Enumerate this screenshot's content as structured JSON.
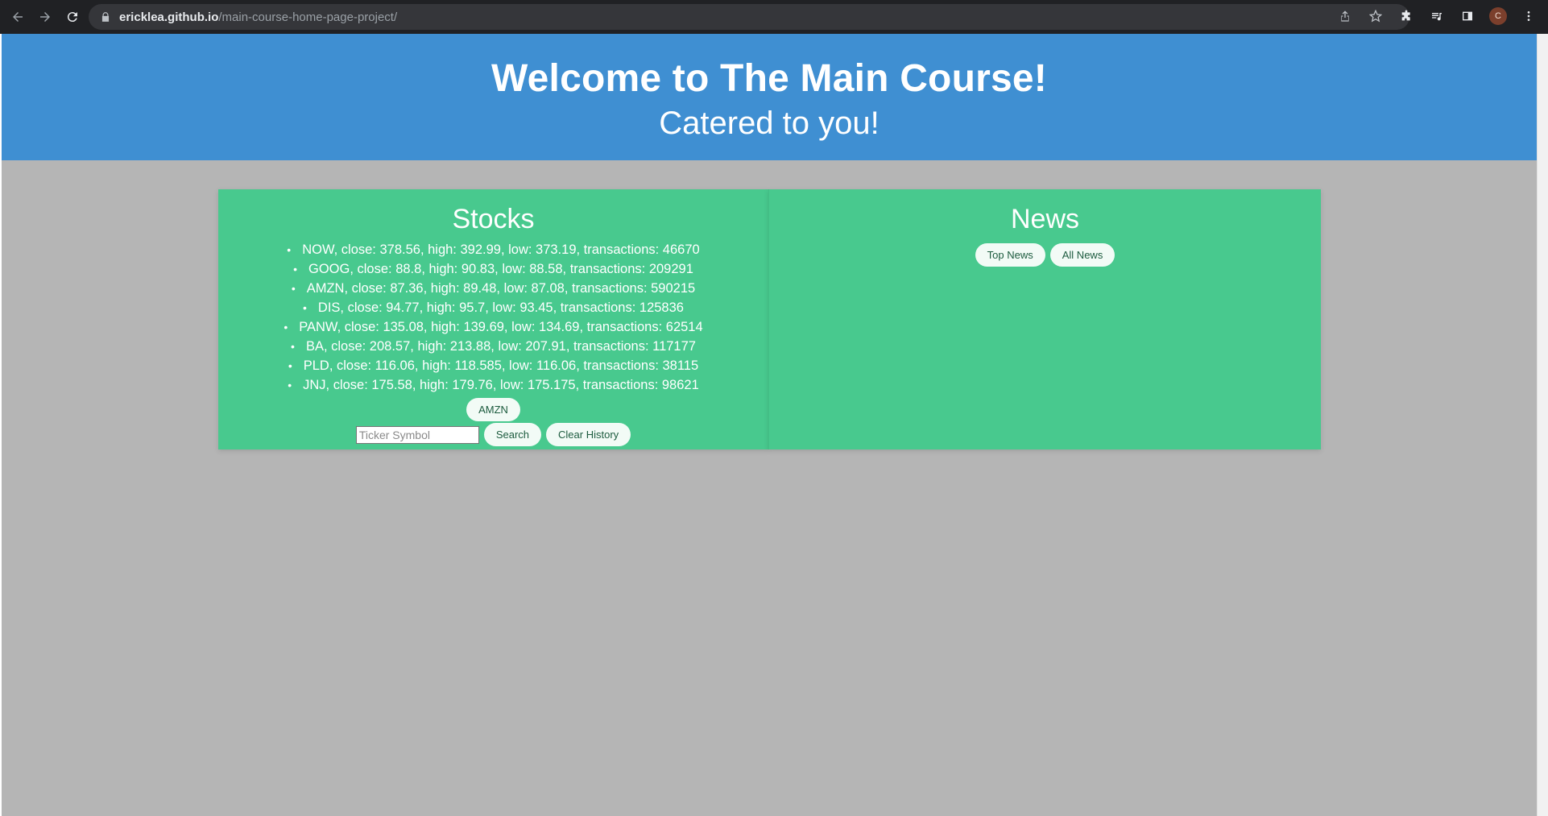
{
  "browser": {
    "url_host": "ericklea.github.io",
    "url_path": "/main-course-home-page-project/",
    "profile_initial": "C"
  },
  "hero": {
    "title": "Welcome to The Main Course!",
    "subtitle": "Catered to you!"
  },
  "stocks": {
    "title": "Stocks",
    "items": [
      "NOW, close: 378.56, high: 392.99, low: 373.19, transactions: 46670",
      "GOOG, close: 88.8, high: 90.83, low: 88.58, transactions: 209291",
      "AMZN, close: 87.36, high: 89.48, low: 87.08, transactions: 590215",
      "DIS, close: 94.77, high: 95.7, low: 93.45, transactions: 125836",
      "PANW, close: 135.08, high: 139.69, low: 134.69, transactions: 62514",
      "BA, close: 208.57, high: 213.88, low: 207.91, transactions: 117177",
      "PLD, close: 116.06, high: 118.585, low: 116.06, transactions: 38115",
      "JNJ, close: 175.58, high: 179.76, low: 175.175, transactions: 98621"
    ],
    "history_button": "AMZN",
    "input_placeholder": "Ticker Symbol",
    "search_label": "Search",
    "clear_label": "Clear History"
  },
  "news": {
    "title": "News",
    "top_label": "Top News",
    "all_label": "All News"
  }
}
